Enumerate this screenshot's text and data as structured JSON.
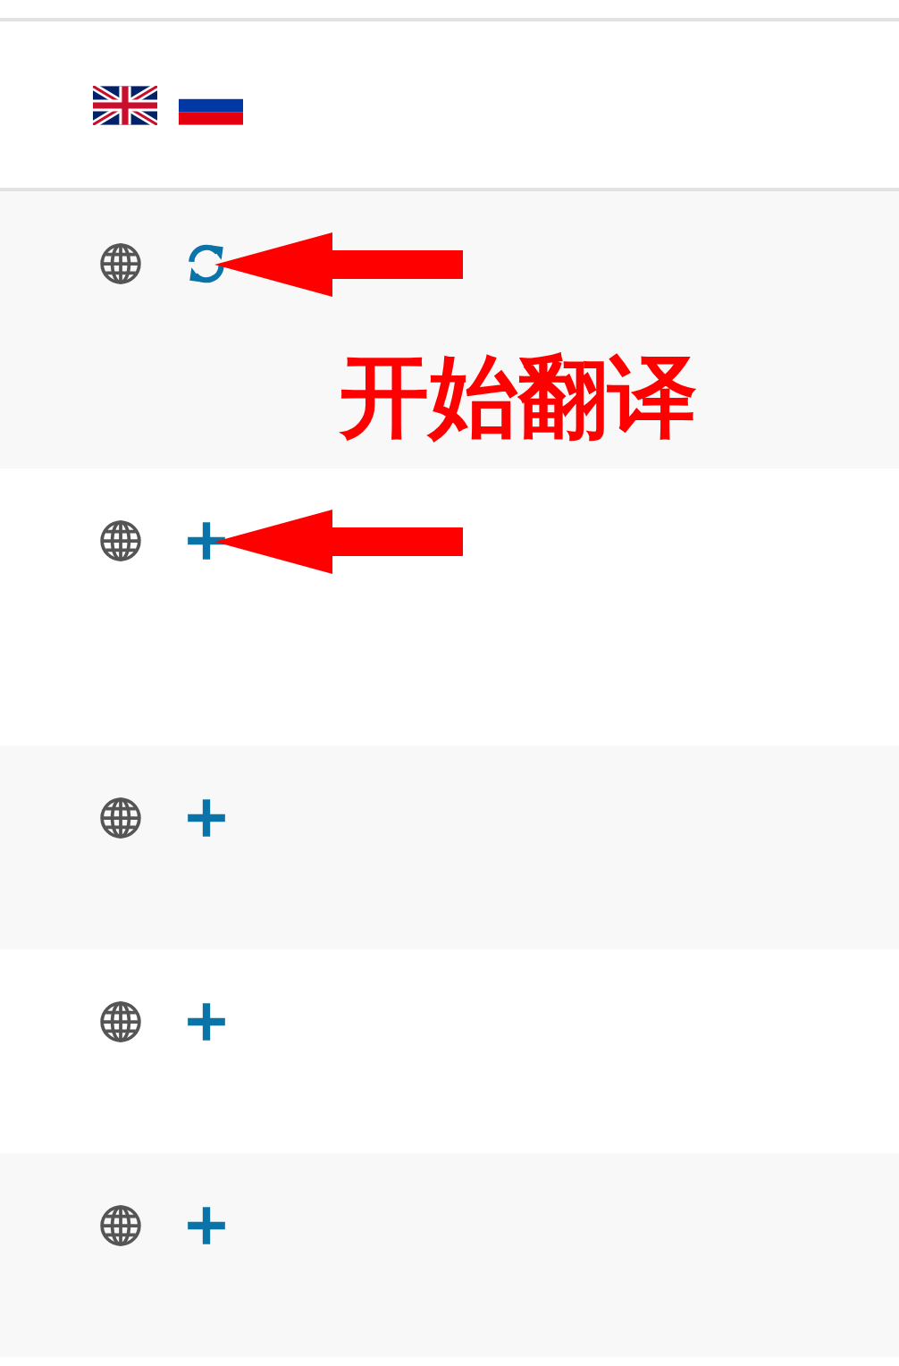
{
  "languages": [
    {
      "kind": "en"
    },
    {
      "kind": "ru"
    }
  ],
  "rows": [
    {
      "kind": "refresh",
      "arrow": true,
      "note": "开始翻译"
    },
    {
      "kind": "add",
      "arrow": true
    },
    {
      "kind": "add",
      "arrow": false
    },
    {
      "kind": "add",
      "arrow": false
    },
    {
      "kind": "add",
      "arrow": false
    }
  ]
}
